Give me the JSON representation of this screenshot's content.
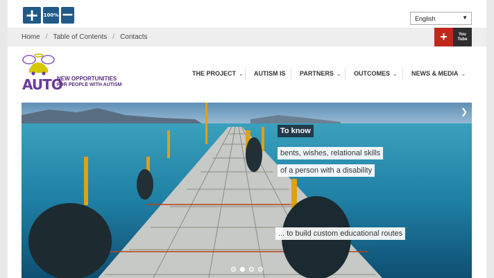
{
  "zoom": {
    "increase": "+",
    "reset": "100%",
    "decrease": "−"
  },
  "language": {
    "selected": "English"
  },
  "breadcrumb": [
    "Home",
    "Table of Contents",
    "Contacts"
  ],
  "social": {
    "gplus": "+",
    "youtube_line1": "You",
    "youtube_line2": "Tube"
  },
  "logo": {
    "word": "AUTO",
    "tagline1": "NEW OPPORTUNITIES",
    "tagline2": "FOR PEOPLE WITH AUTISM"
  },
  "nav": [
    {
      "label": "THE PROJECT",
      "dropdown": true
    },
    {
      "label": "AUTISM IS",
      "dropdown": false
    },
    {
      "label": "PARTNERS",
      "dropdown": true
    },
    {
      "label": "OUTCOMES",
      "dropdown": true
    },
    {
      "label": "NEWS & MEDIA",
      "dropdown": true
    }
  ],
  "hero": {
    "title": "To know",
    "line1": "bents, wishes, relational skills",
    "line2": "of a person with a disability",
    "line3": "... to build custom educational routes",
    "slide_count": 4,
    "active_slide": 1
  },
  "colors": {
    "zoom_button": "#215a86",
    "brand_purple": "#6a3a9a",
    "gplus": "#c1271b"
  }
}
